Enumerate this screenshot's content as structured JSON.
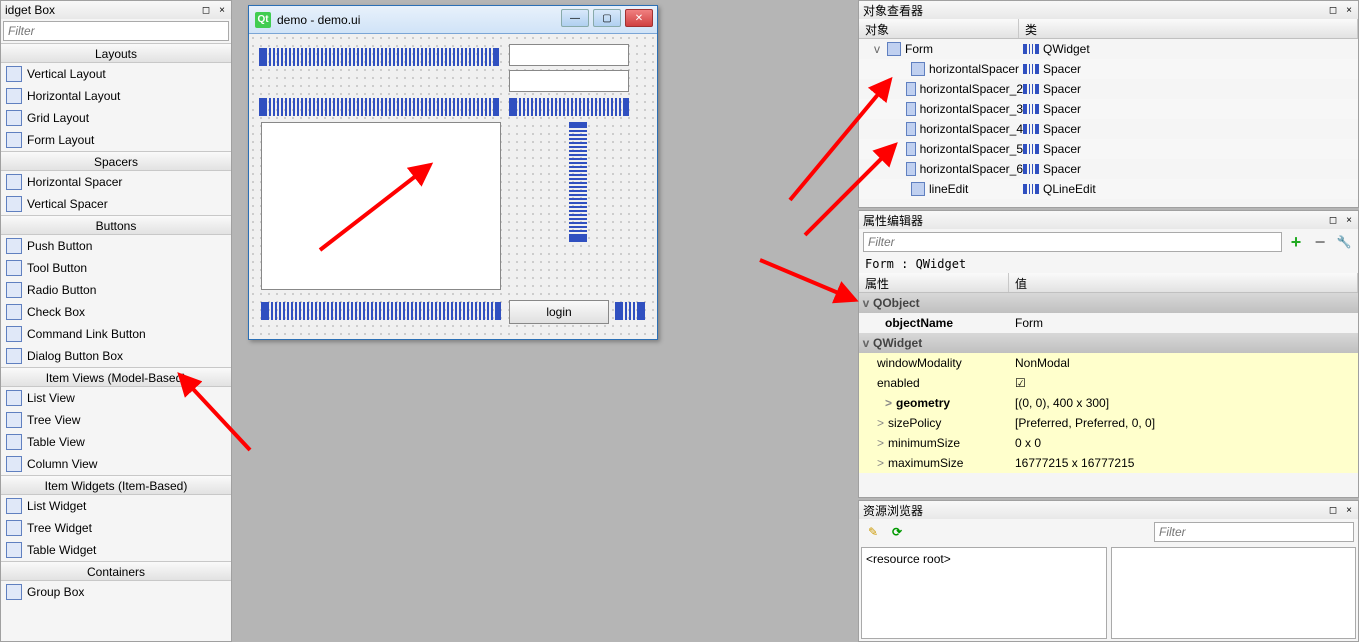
{
  "widgetBox": {
    "title": "idget Box",
    "filter": "Filter",
    "categories": [
      {
        "label": "Layouts",
        "items": [
          "Vertical Layout",
          "Horizontal Layout",
          "Grid Layout",
          "Form Layout"
        ]
      },
      {
        "label": "Spacers",
        "items": [
          "Horizontal Spacer",
          "Vertical Spacer"
        ]
      },
      {
        "label": "Buttons",
        "items": [
          "Push Button",
          "Tool Button",
          "Radio Button",
          "Check Box",
          "Command Link Button",
          "Dialog Button Box"
        ]
      },
      {
        "label": "Item Views (Model-Based)",
        "items": [
          "List View",
          "Tree View",
          "Table View",
          "Column View"
        ]
      },
      {
        "label": "Item Widgets (Item-Based)",
        "items": [
          "List Widget",
          "Tree Widget",
          "Table Widget"
        ]
      },
      {
        "label": "Containers",
        "items": [
          "Group Box"
        ]
      }
    ]
  },
  "designerWindow": {
    "title": "demo - demo.ui",
    "loginButton": "login"
  },
  "objectInspector": {
    "title": "对象查看器",
    "headers": {
      "obj": "对象",
      "cls": "类"
    },
    "rows": [
      {
        "obj": "Form",
        "cls": "QWidget",
        "indent": 0,
        "expand": "v"
      },
      {
        "obj": "horizontalSpacer",
        "cls": "Spacer",
        "indent": 1
      },
      {
        "obj": "horizontalSpacer_2",
        "cls": "Spacer",
        "indent": 1
      },
      {
        "obj": "horizontalSpacer_3",
        "cls": "Spacer",
        "indent": 1
      },
      {
        "obj": "horizontalSpacer_4",
        "cls": "Spacer",
        "indent": 1
      },
      {
        "obj": "horizontalSpacer_5",
        "cls": "Spacer",
        "indent": 1
      },
      {
        "obj": "horizontalSpacer_6",
        "cls": "Spacer",
        "indent": 1
      },
      {
        "obj": "lineEdit",
        "cls": "QLineEdit",
        "indent": 1
      }
    ]
  },
  "propertyEditor": {
    "title": "属性编辑器",
    "filter": "Filter",
    "breadcrumb": "Form : QWidget",
    "headers": {
      "prop": "属性",
      "val": "值"
    },
    "rows": [
      {
        "type": "group",
        "name": "QObject"
      },
      {
        "type": "prop",
        "name": "objectName",
        "val": "Form",
        "bold": true
      },
      {
        "type": "group",
        "name": "QWidget"
      },
      {
        "type": "prop",
        "name": "windowModality",
        "val": "NonModal",
        "yellow": true
      },
      {
        "type": "prop",
        "name": "enabled",
        "val": "☑",
        "yellow": true
      },
      {
        "type": "prop",
        "name": "geometry",
        "val": "[(0, 0), 400 x 300]",
        "bold": true,
        "yellow": true,
        "expand": ">"
      },
      {
        "type": "prop",
        "name": "sizePolicy",
        "val": "[Preferred, Preferred, 0, 0]",
        "yellow": true,
        "expand": ">"
      },
      {
        "type": "prop",
        "name": "minimumSize",
        "val": "0 x 0",
        "yellow": true,
        "expand": ">"
      },
      {
        "type": "prop",
        "name": "maximumSize",
        "val": "16777215 x 16777215",
        "yellow": true,
        "expand": ">"
      }
    ]
  },
  "resourceBrowser": {
    "title": "资源浏览器",
    "filter": "Filter",
    "root": "<resource root>"
  }
}
